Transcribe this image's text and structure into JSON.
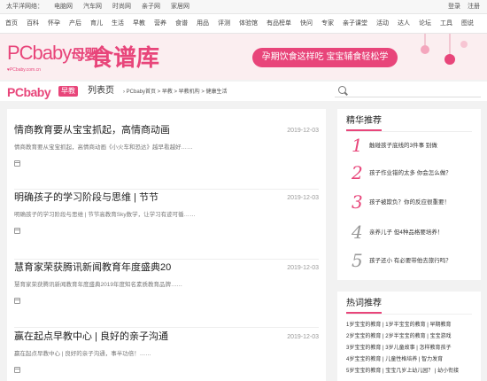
{
  "topbar": {
    "sites": [
      "太平洋网络：",
      "电脑网",
      "汽车网",
      "时尚网",
      "亲子网",
      "家居网"
    ],
    "login": "登录",
    "register": "注册"
  },
  "nav": {
    "items": [
      "首页",
      "百科",
      "怀孕",
      "产后",
      "育儿",
      "生活",
      "早教",
      "营养",
      "食谱",
      "用品",
      "评测",
      "体验馆",
      "有品榜单",
      "快问",
      "专家",
      "亲子课堂",
      "活动",
      "达人",
      "论坛",
      "工具",
      "图说"
    ]
  },
  "banner": {
    "logo_pc": "PCbaby",
    "logo_cn": "母婴",
    "title": "食谱库",
    "domain": "♥PCbaby.com.cn",
    "slogan": "孕期饮食这样吃  宝宝辅食轻松学"
  },
  "crumb": {
    "brand": "PCbaby",
    "tag": "早教",
    "page": "列表页",
    "path": "›  PCbaby首页  >  早教  >  早教机构  >  健康生活",
    "search_placeholder": ""
  },
  "articles": [
    {
      "title": "情商教育要从宝宝抓起，高情商动画",
      "date": "2019-12-03",
      "summary": "情商教育要从宝宝抓起，高情商动画《小火车和恐达》越早看越好……"
    },
    {
      "title": "明确孩子的学习阶段与思维 | 节节",
      "date": "2019-12-03",
      "summary": "明确孩子的学习阶段与思维 | 节节高教育Sky数学，让学习有迹可循……"
    },
    {
      "title": "慧育家荣获腾讯新闻教育年度盛典20",
      "date": "2019-12-03",
      "summary": "慧育家荣获腾讯新闻教育年度盛典2019年度知名素质教育品牌……"
    },
    {
      "title": "赢在起点早教中心 | 良好的亲子沟通",
      "date": "2019-12-03",
      "summary": "赢在起点早教中心 | 良好的亲子沟通，事半功倍！……"
    }
  ],
  "recommend": {
    "title": "精华推荐",
    "items": [
      {
        "num": "1",
        "text": "触碰孩子底线的3件事 别做"
      },
      {
        "num": "2",
        "text": "孩子作业错的太多 你会怎么做？"
      },
      {
        "num": "3",
        "text": "孩子被欺负？你的反应很重要！"
      },
      {
        "num": "4",
        "text": "亲养儿子 但4种品格要培养！"
      },
      {
        "num": "5",
        "text": "孩子还小 有必要带他去旅行吗？"
      }
    ]
  },
  "hot": {
    "title": "热词推荐",
    "rows": [
      "1岁宝宝的教育  |  1岁半宝宝的教育  |  早期教育",
      "2岁宝宝的教育  |  2岁半宝宝的教育  |  宝宝游戏",
      "3岁宝宝的教育  |  3岁儿童故事  |  怎样教育孩子",
      "4岁宝宝的教育  |  儿童性格培养  |  智力发育",
      "5岁宝宝的教育  |  宝宝几岁上幼儿园？  |  幼小衔接"
    ]
  },
  "colors": {
    "accent": "#e8457a",
    "background": "#f2f2f2"
  }
}
